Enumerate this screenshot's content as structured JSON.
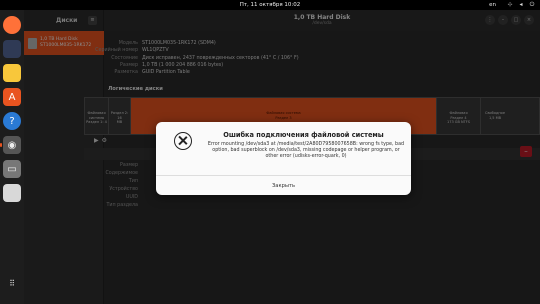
{
  "topbar": {
    "clock": "Пт, 11 октября  10:02",
    "lang": "en"
  },
  "sidebar": {
    "title": "Диски",
    "disk": {
      "line1": "1,0 TB Hard Disk",
      "line2": "ST1000LM035-1RK172"
    }
  },
  "header": {
    "title": "1,0 TB Hard Disk",
    "subtitle": "/dev/sda"
  },
  "props": [
    {
      "k": "Модель",
      "v": "ST1000LM035-1RK172 (SDM4)"
    },
    {
      "k": "Серийный номер",
      "v": "WL1QPZTV"
    },
    {
      "k": "Состояние",
      "v": "Диск исправен, 2437 поврежденных секторов (41° C / 106° F)"
    },
    {
      "k": "Размер",
      "v": "1,0 TB (1 000 204 886 016 bytes)"
    },
    {
      "k": "Разметка",
      "v": "GUID Partition Table"
    }
  ],
  "section": "Логические диски",
  "partitions": [
    {
      "label": "Файловая система\nРаздел 1: 4"
    },
    {
      "label": "Раздел 2: 16\nMB"
    },
    {
      "label": "Файловая система\nРаздел 3"
    },
    {
      "label": "Файловая\nРаздел 4\n173 GB NTFS"
    },
    {
      "label": "Свободное\n1,5 MB"
    }
  ],
  "props2": [
    "Размер",
    "Содержимое",
    "Тип",
    "Устройство",
    "UUID",
    "Тип раздела"
  ],
  "dialog": {
    "title": "Ошибка подключения файловой системы",
    "message": "Error mounting /dev/sda3 at /media/test/2A80D7958007658B: wrong fs type, bad option, bad superblock on /dev/sda3, missing codepage or helper program, or other error (udisks-error-quark, 0)",
    "button": "Закрыть"
  }
}
